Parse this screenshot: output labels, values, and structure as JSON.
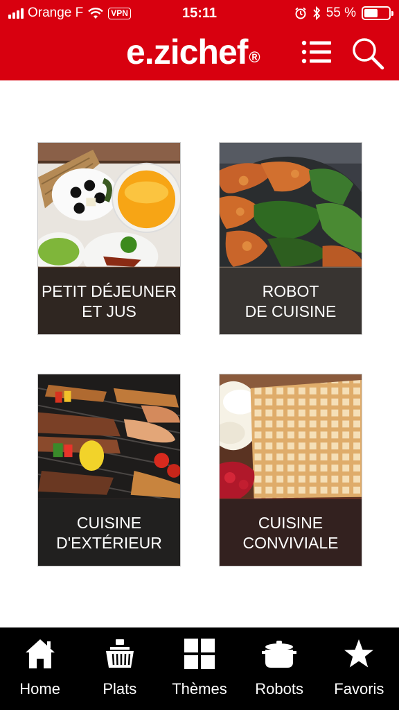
{
  "status_bar": {
    "carrier": "Orange F",
    "vpn": "VPN",
    "time": "15:11",
    "battery_pct": "55 %",
    "battery_level": 0.55
  },
  "header": {
    "logo": "e.zichef",
    "logo_mark": "®",
    "menu_icon": "list-menu-icon",
    "search_icon": "search-icon",
    "brand_color": "#d8000f"
  },
  "categories": [
    {
      "line1": "PETIT DÉJEUNER",
      "line2": "ET JUS"
    },
    {
      "line1": "ROBOT",
      "line2": "DE CUISINE"
    },
    {
      "line1": "CUISINE",
      "line2": "D'EXTÉRIEUR"
    },
    {
      "line1": "CUISINE",
      "line2": "CONVIVIALE"
    }
  ],
  "tabs": [
    {
      "label": "Home",
      "icon": "home-icon"
    },
    {
      "label": "Plats",
      "icon": "basket-icon"
    },
    {
      "label": "Thèmes",
      "icon": "grid-icon"
    },
    {
      "label": "Robots",
      "icon": "pot-icon"
    },
    {
      "label": "Favoris",
      "icon": "star-icon"
    }
  ]
}
